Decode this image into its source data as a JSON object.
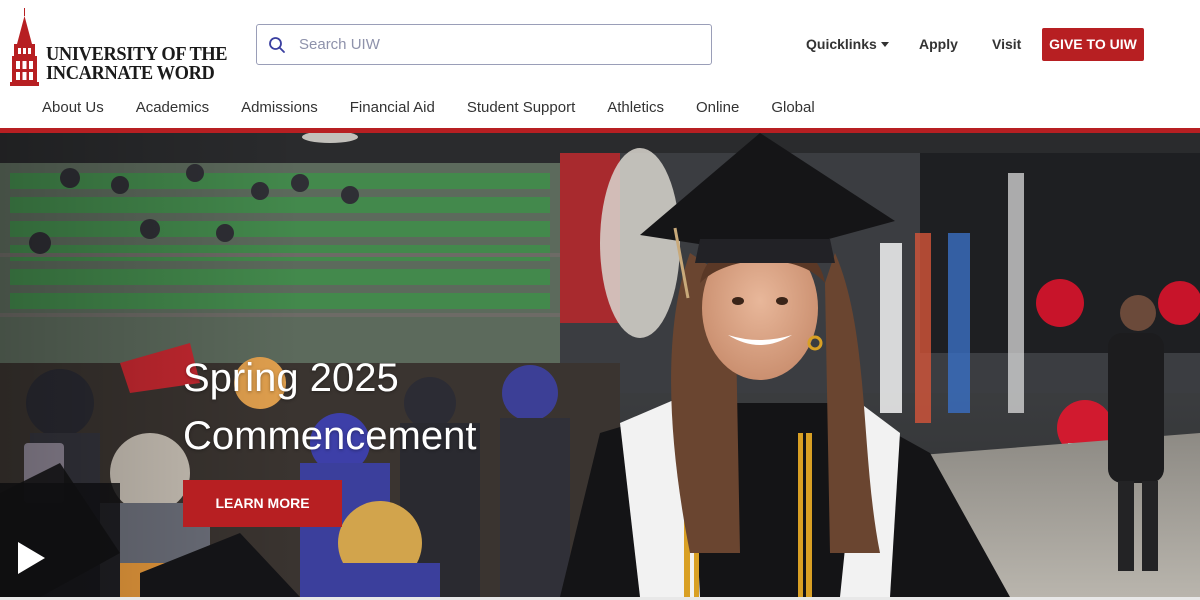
{
  "brand": {
    "name_line1": "UNIVERSITY OF THE",
    "name_line2": "INCARNATE WORD",
    "accent_color": "#b71f22"
  },
  "search": {
    "placeholder": "Search UIW",
    "icon": "search-icon"
  },
  "utility_nav": {
    "quicklinks": "Quicklinks",
    "apply": "Apply",
    "visit": "Visit",
    "give": "GIVE TO UIW"
  },
  "main_nav": [
    {
      "label": "About Us"
    },
    {
      "label": "Academics"
    },
    {
      "label": "Admissions"
    },
    {
      "label": "Financial Aid"
    },
    {
      "label": "Student Support"
    },
    {
      "label": "Athletics"
    },
    {
      "label": "Online"
    },
    {
      "label": "Global"
    }
  ],
  "hero": {
    "title_line1": "Spring 2025",
    "title_line2": "Commencement",
    "cta": "LEARN MORE",
    "play_icon": "play-icon"
  }
}
